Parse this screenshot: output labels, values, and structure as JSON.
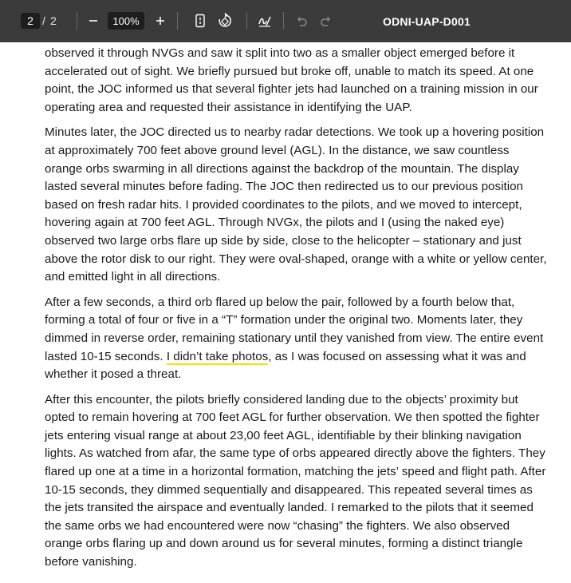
{
  "toolbar": {
    "current_page": "2",
    "page_separator": "/",
    "total_pages": "2",
    "zoom": "100%",
    "document_title": "ODNI-UAP-D001",
    "icons": [
      "zoom-out-icon",
      "zoom-in-icon",
      "fit-page-icon",
      "rotate-icon",
      "draw-icon",
      "undo-icon",
      "redo-icon"
    ]
  },
  "document": {
    "paragraphs": [
      {
        "text": "observed it through NVGs and saw it split into two as a smaller object emerged before it accelerated out of sight.  We briefly pursued but broke off, unable to match its speed.  At one point, the JOC informed us that several fighter jets had launched on a training mission in our operating area and requested their assistance in identifying the UAP."
      },
      {
        "text": "Minutes later, the JOC directed us to nearby radar detections.  We took up a hovering position at approximately 700 feet above ground level (AGL).  In the distance, we saw countless orange orbs swarming in all directions against the backdrop of the mountain.  The display lasted several minutes before fading.  The JOC then redirected us to our previous position based on fresh radar hits.  I provided coordinates to the pilots, and we moved to intercept, hovering again at 700 feet AGL. Through NVGx, the pilots and I (using the naked eye) observed two large orbs flare up side by side, close to the helicopter – stationary and just above the rotor disk to our right.  They were oval-shaped, orange with a white or yellow center, and emitted light in all directions."
      },
      {
        "text_before": "After a few seconds, a third orb flared up below the pair, followed by a fourth below that, forming a total of four or five in a “T” formation under the original two.  Moments later, they dimmed in reverse order, remaining stationary until they vanished from view.  The entire event lasted 10-15 seconds.  ",
        "highlight": "I didn’t take photos",
        "text_after": ", as I was focused on assessing what it was and whether it posed a threat.",
        "highlight_color": "#f2e200"
      },
      {
        "text": "After this encounter, the pilots briefly considered landing due to the objects’ proximity but opted to remain hovering at 700 feet AGL for further observation.  We then spotted the fighter jets entering visual range at about 23,00 feet AGL, identifiable by their blinking navigation lights.  As watched from afar, the same type of orbs appeared directly above the fighters.  They flared up one at a time in a horizontal formation, matching the jets’ speed and flight path.  After 10-15 seconds, they dimmed sequentially and disappeared.  This repeated several times as the jets transited the airspace and eventually landed.  I remarked to the pilots that it seemed the same orbs we had encountered were now “chasing” the fighters.  We also observed orange orbs flaring up and down around us for several minutes, forming a distinct triangle before vanishing."
      }
    ]
  }
}
